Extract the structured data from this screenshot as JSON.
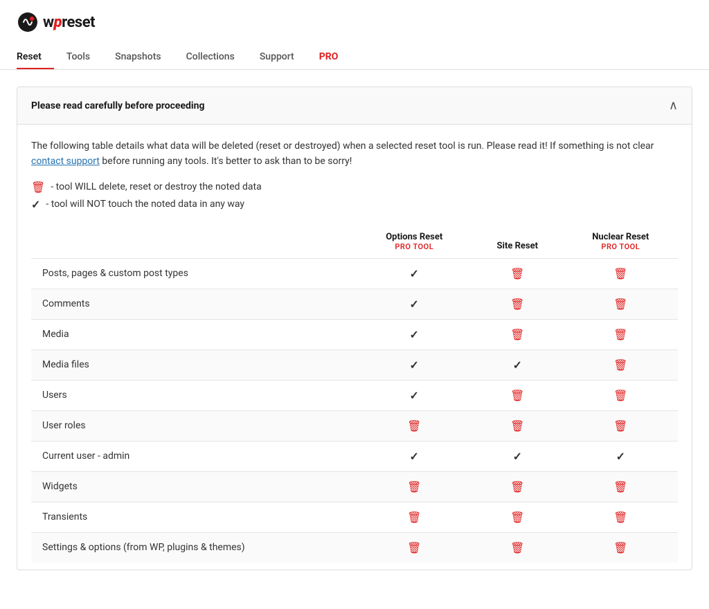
{
  "logo": {
    "text_before": "w",
    "icon_symbol": "⟳",
    "text_after": "reset",
    "alt": "WPReset"
  },
  "nav": {
    "items": [
      {
        "id": "reset",
        "label": "Reset",
        "active": true,
        "pro": false
      },
      {
        "id": "tools",
        "label": "Tools",
        "active": false,
        "pro": false
      },
      {
        "id": "snapshots",
        "label": "Snapshots",
        "active": false,
        "pro": false
      },
      {
        "id": "collections",
        "label": "Collections",
        "active": false,
        "pro": false
      },
      {
        "id": "support",
        "label": "Support",
        "active": false,
        "pro": false
      },
      {
        "id": "pro",
        "label": "PRO",
        "active": false,
        "pro": true
      }
    ]
  },
  "info_box": {
    "title": "Please read carefully before proceeding",
    "chevron": "∧",
    "body_text": "The following table details what data will be deleted (reset or destroyed) when a selected reset tool is run. Please read it! If something is not clear",
    "link_text": "contact support",
    "body_text2": "before running any tools. It's better to ask than to be sorry!",
    "legend": [
      {
        "icon": "trash",
        "text": "- tool WILL delete, reset or destroy the noted data"
      },
      {
        "icon": "check",
        "text": "- tool will NOT touch the noted data in any way"
      }
    ]
  },
  "table": {
    "columns": [
      {
        "id": "item",
        "label": "",
        "sub": ""
      },
      {
        "id": "options_reset",
        "label": "Options Reset",
        "sub": "PRO TOOL"
      },
      {
        "id": "site_reset",
        "label": "Site Reset",
        "sub": ""
      },
      {
        "id": "nuclear_reset",
        "label": "Nuclear Reset",
        "sub": "PRO TOOL"
      }
    ],
    "rows": [
      {
        "label": "Posts, pages & custom post types",
        "options_reset": "check",
        "site_reset": "trash",
        "nuclear_reset": "trash"
      },
      {
        "label": "Comments",
        "options_reset": "check",
        "site_reset": "trash",
        "nuclear_reset": "trash"
      },
      {
        "label": "Media",
        "options_reset": "check",
        "site_reset": "trash",
        "nuclear_reset": "trash"
      },
      {
        "label": "Media files",
        "options_reset": "check",
        "site_reset": "check",
        "nuclear_reset": "trash"
      },
      {
        "label": "Users",
        "options_reset": "check",
        "site_reset": "trash",
        "nuclear_reset": "trash"
      },
      {
        "label": "User roles",
        "options_reset": "trash",
        "site_reset": "trash",
        "nuclear_reset": "trash"
      },
      {
        "label": "Current user - admin",
        "options_reset": "check",
        "site_reset": "check",
        "nuclear_reset": "check"
      },
      {
        "label": "Widgets",
        "options_reset": "trash",
        "site_reset": "trash",
        "nuclear_reset": "trash"
      },
      {
        "label": "Transients",
        "options_reset": "trash",
        "site_reset": "trash",
        "nuclear_reset": "trash"
      },
      {
        "label": "Settings & options (from WP, plugins & themes)",
        "options_reset": "trash",
        "site_reset": "trash",
        "nuclear_reset": "trash"
      }
    ]
  }
}
